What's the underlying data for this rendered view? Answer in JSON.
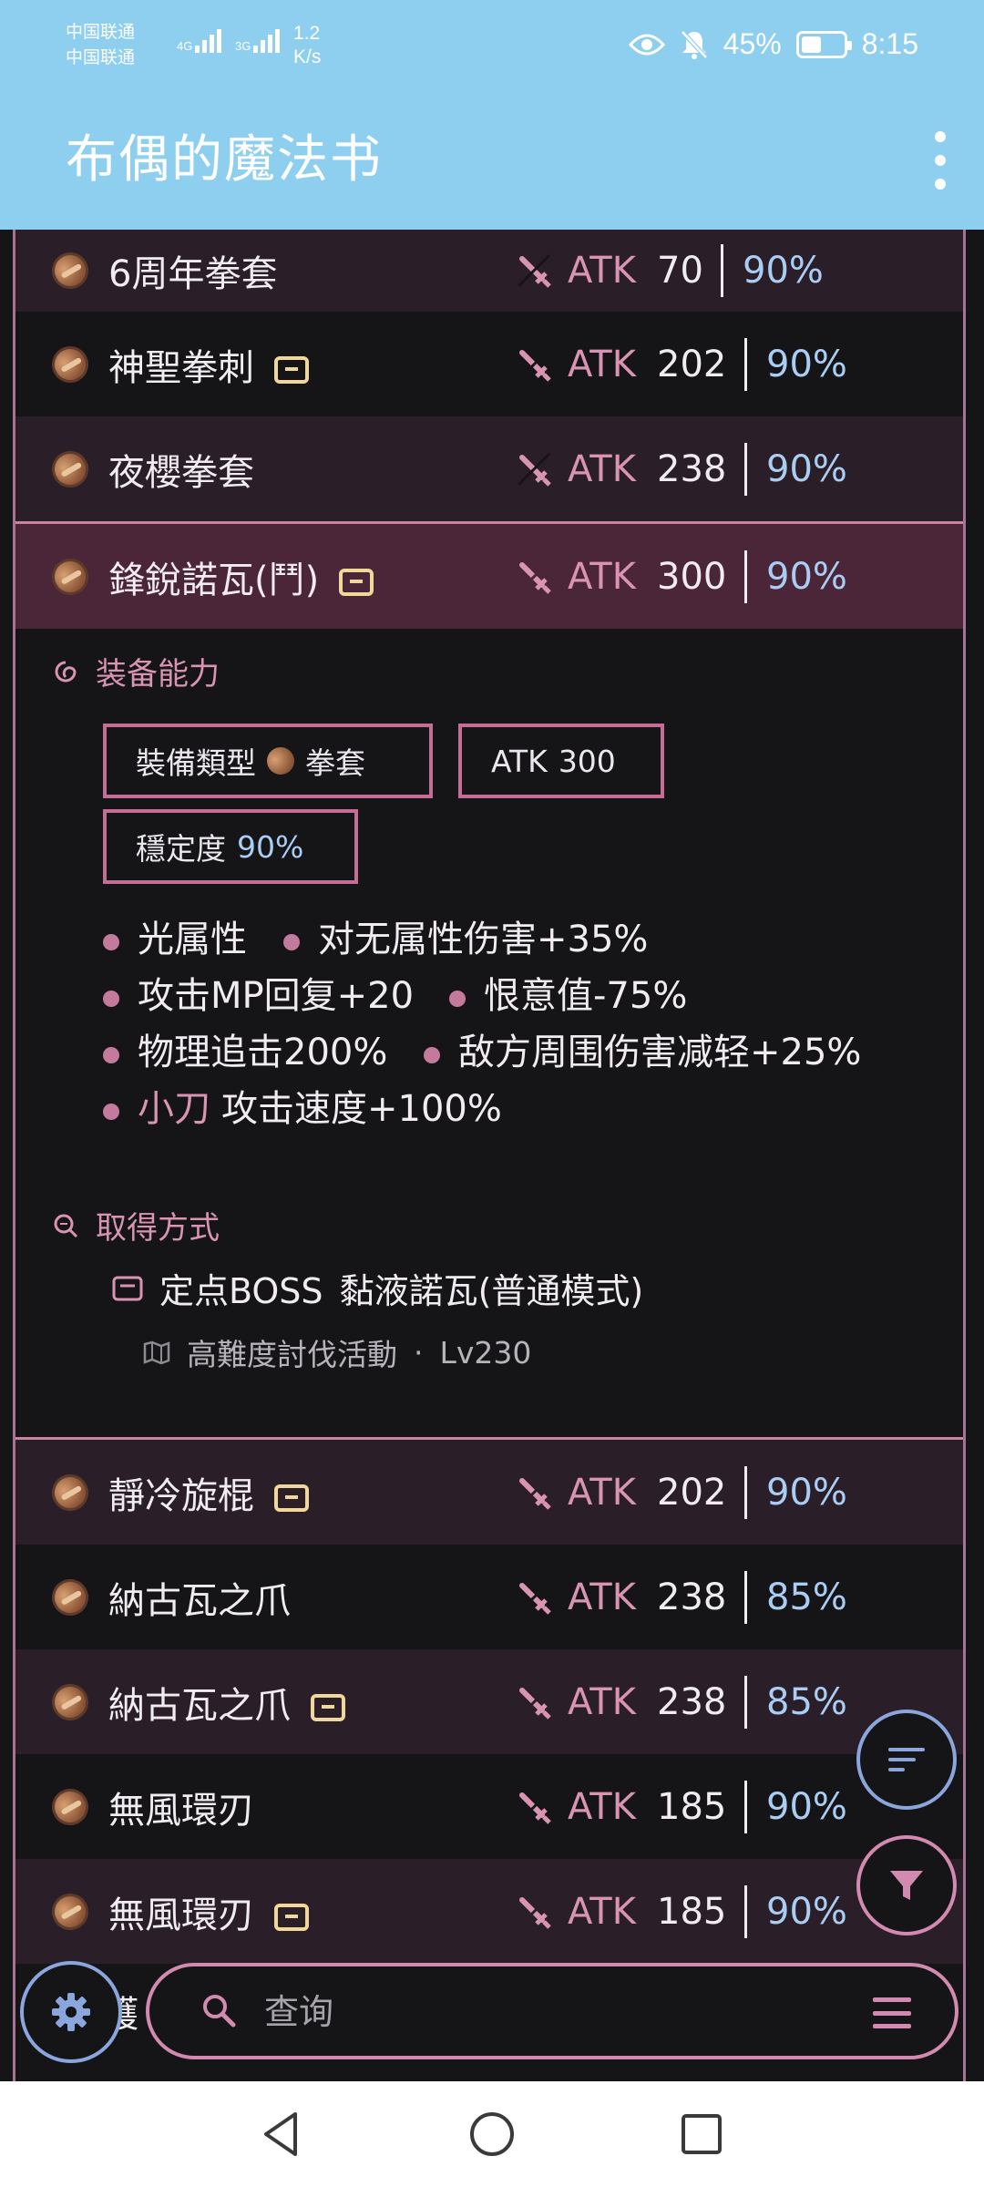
{
  "status": {
    "carrier1": "中国联通",
    "carrier2": "中国联通",
    "net1": "4G",
    "net2": "3G",
    "speed_value": "1.2",
    "speed_unit": "K/s",
    "battery": "45%",
    "time": "8:15"
  },
  "app": {
    "title": "布偶的魔法书"
  },
  "weapons_top": [
    {
      "name": "6周年拳套",
      "atk_label": "ATK",
      "atk": "70",
      "stability": "90%",
      "has_box": false
    },
    {
      "name": "神聖拳刺",
      "atk_label": "ATK",
      "atk": "202",
      "stability": "90%",
      "has_box": true
    },
    {
      "name": "夜櫻拳套",
      "atk_label": "ATK",
      "atk": "238",
      "stability": "90%",
      "has_box": false
    }
  ],
  "selected": {
    "name": "鋒銳諾瓦(鬥)",
    "atk_label": "ATK",
    "atk": "300",
    "stability": "90%"
  },
  "detail": {
    "ability_heading": "装备能力",
    "chip_type_label": "裝備類型",
    "chip_type_value": "拳套",
    "chip_atk_label": "ATK",
    "chip_atk_value": "300",
    "chip_stab_label": "穩定度",
    "chip_stab_value": "90%",
    "attrs": [
      "光属性",
      "对无属性伤害+35%",
      "攻击MP回复+20",
      "恨意值-75%",
      "物理追击200%",
      "敌方周围伤害减轻+25%",
      "攻击速度+100%"
    ],
    "attr_prefix": "小刀",
    "obtain_heading": "取得方式",
    "obtain_type": "定点BOSS",
    "obtain_name": "黏液諾瓦(普通模式)",
    "obtain_location": "高難度討伐活動",
    "obtain_sep": "·",
    "obtain_level": "Lv230"
  },
  "weapons_bottom": [
    {
      "name": "靜冷旋棍",
      "atk_label": "ATK",
      "atk": "202",
      "stability": "90%",
      "has_box": true
    },
    {
      "name": "納古瓦之爪",
      "atk_label": "ATK",
      "atk": "238",
      "stability": "85%",
      "has_box": false
    },
    {
      "name": "納古瓦之爪",
      "atk_label": "ATK",
      "atk": "238",
      "stability": "85%",
      "has_box": true
    },
    {
      "name": "無風環刃",
      "atk_label": "ATK",
      "atk": "185",
      "stability": "90%",
      "has_box": false
    },
    {
      "name": "無風環刃",
      "atk_label": "ATK",
      "atk": "185",
      "stability": "90%",
      "has_box": true
    }
  ],
  "peek": "護",
  "search": {
    "placeholder": "查询"
  },
  "colors": {
    "app_bar": "#8ecff0",
    "accent_pink": "#d994b4",
    "accent_blue": "#aacdf4"
  }
}
